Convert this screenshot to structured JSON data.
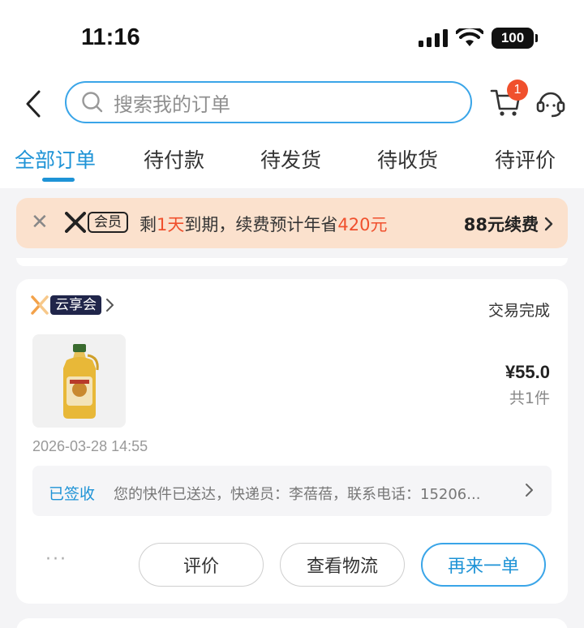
{
  "status_bar": {
    "time": "11:16",
    "battery": "100"
  },
  "header": {
    "search_placeholder": "搜索我的订单",
    "cart_badge": "1"
  },
  "tabs": [
    {
      "label": "全部订单",
      "active": true
    },
    {
      "label": "待付款",
      "active": false
    },
    {
      "label": "待发货",
      "active": false
    },
    {
      "label": "待收货",
      "active": false
    },
    {
      "label": "待评价",
      "active": false
    }
  ],
  "promo": {
    "vip_label": "会员",
    "text_prefix": "剩",
    "days": "1天",
    "text_mid": "到期，续费预计年省",
    "save": "420元",
    "renew": "88元续费"
  },
  "order": {
    "shop_tag": "云享会",
    "status": "交易完成",
    "price": "¥55.0",
    "quantity": "共1件",
    "time": "2026-03-28 14:55",
    "logistics_status": "已签收",
    "logistics_text": "您的快件已送达，快递员：李蓓蓓，联系电话：15206...",
    "more": "···",
    "buttons": {
      "review": "评价",
      "logistics": "查看物流",
      "reorder": "再来一单"
    }
  },
  "colors": {
    "accent": "#1e93d6",
    "badge": "#f0502d",
    "promo_bg": "#fbe1cd",
    "shop_tag_bg": "#20254a"
  }
}
